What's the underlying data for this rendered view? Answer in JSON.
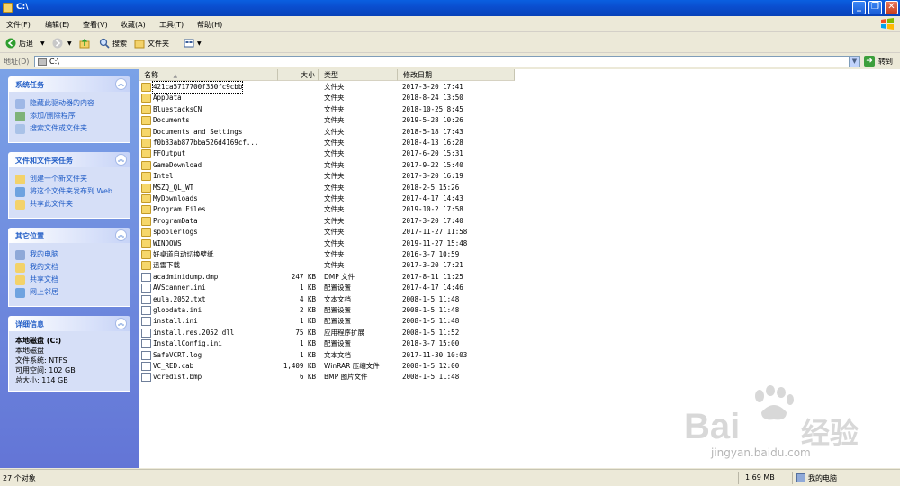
{
  "window": {
    "title": "C:\\"
  },
  "menu": [
    "文件(F)",
    "编辑(E)",
    "查看(V)",
    "收藏(A)",
    "工具(T)",
    "帮助(H)"
  ],
  "toolbar": {
    "back": "后退",
    "search": "搜索",
    "folders": "文件夹"
  },
  "address": {
    "label": "地址(D)",
    "value": "C:\\",
    "go": "转到"
  },
  "tasks": {
    "system": {
      "title": "系统任务",
      "items": [
        "隐藏此驱动器的内容",
        "添加/删除程序",
        "搜索文件或文件夹"
      ]
    },
    "file": {
      "title": "文件和文件夹任务",
      "items": [
        "创建一个新文件夹",
        "将这个文件夹发布到 Web",
        "共享此文件夹"
      ]
    },
    "other": {
      "title": "其它位置",
      "items": [
        "我的电脑",
        "我的文档",
        "共享文档",
        "网上邻居"
      ]
    },
    "details": {
      "title": "详细信息",
      "name": "本地磁盘 (C:)",
      "type": "本地磁盘",
      "fs": "文件系统: NTFS",
      "free": "可用空间: 102 GB",
      "total": "总大小: 114 GB"
    }
  },
  "columns": {
    "name": "名称",
    "size": "大小",
    "type": "类型",
    "date": "修改日期"
  },
  "files": [
    {
      "name": "421ca5717700f350fc9cbb",
      "size": "",
      "type": "文件夹",
      "date": "2017-3-20 17:41",
      "kind": "folder"
    },
    {
      "name": "AppData",
      "size": "",
      "type": "文件夹",
      "date": "2018-8-24 13:50",
      "kind": "folder"
    },
    {
      "name": "BluestacksCN",
      "size": "",
      "type": "文件夹",
      "date": "2018-10-25 8:45",
      "kind": "folder"
    },
    {
      "name": "Documents",
      "size": "",
      "type": "文件夹",
      "date": "2019-5-28 10:26",
      "kind": "folder"
    },
    {
      "name": "Documents and Settings",
      "size": "",
      "type": "文件夹",
      "date": "2018-5-18 17:43",
      "kind": "folder"
    },
    {
      "name": "f0b33ab877bba526d4169cf...",
      "size": "",
      "type": "文件夹",
      "date": "2018-4-13 16:28",
      "kind": "folder"
    },
    {
      "name": "FFOutput",
      "size": "",
      "type": "文件夹",
      "date": "2017-6-20 15:31",
      "kind": "folder"
    },
    {
      "name": "GameDownload",
      "size": "",
      "type": "文件夹",
      "date": "2017-9-22 15:40",
      "kind": "folder"
    },
    {
      "name": "Intel",
      "size": "",
      "type": "文件夹",
      "date": "2017-3-20 16:19",
      "kind": "folder"
    },
    {
      "name": "MSZQ_QL_WT",
      "size": "",
      "type": "文件夹",
      "date": "2018-2-5 15:26",
      "kind": "folder"
    },
    {
      "name": "MyDownloads",
      "size": "",
      "type": "文件夹",
      "date": "2017-4-17 14:43",
      "kind": "folder"
    },
    {
      "name": "Program Files",
      "size": "",
      "type": "文件夹",
      "date": "2019-10-2 17:58",
      "kind": "folder"
    },
    {
      "name": "ProgramData",
      "size": "",
      "type": "文件夹",
      "date": "2017-3-20 17:40",
      "kind": "folder"
    },
    {
      "name": "spoolerlogs",
      "size": "",
      "type": "文件夹",
      "date": "2017-11-27 11:58",
      "kind": "folder"
    },
    {
      "name": "WINDOWS",
      "size": "",
      "type": "文件夹",
      "date": "2019-11-27 15:48",
      "kind": "folder"
    },
    {
      "name": "好桌道自动切换壁纸",
      "size": "",
      "type": "文件夹",
      "date": "2016-3-7 10:59",
      "kind": "folder"
    },
    {
      "name": "迅雷下载",
      "size": "",
      "type": "文件夹",
      "date": "2017-3-20 17:21",
      "kind": "folder"
    },
    {
      "name": "acadminidump.dmp",
      "size": "247 KB",
      "type": "DMP 文件",
      "date": "2017-8-11 11:25",
      "kind": "file"
    },
    {
      "name": "AVScanner.ini",
      "size": "1 KB",
      "type": "配置设置",
      "date": "2017-4-17 14:46",
      "kind": "file"
    },
    {
      "name": "eula.2052.txt",
      "size": "4 KB",
      "type": "文本文档",
      "date": "2008-1-5 11:48",
      "kind": "file"
    },
    {
      "name": "globdata.ini",
      "size": "2 KB",
      "type": "配置设置",
      "date": "2008-1-5 11:48",
      "kind": "file"
    },
    {
      "name": "install.ini",
      "size": "1 KB",
      "type": "配置设置",
      "date": "2008-1-5 11:48",
      "kind": "file"
    },
    {
      "name": "install.res.2052.dll",
      "size": "75 KB",
      "type": "应用程序扩展",
      "date": "2008-1-5 11:52",
      "kind": "file"
    },
    {
      "name": "InstallConfig.ini",
      "size": "1 KB",
      "type": "配置设置",
      "date": "2018-3-7 15:00",
      "kind": "file"
    },
    {
      "name": "SafeVCRT.log",
      "size": "1 KB",
      "type": "文本文档",
      "date": "2017-11-30 10:03",
      "kind": "file"
    },
    {
      "name": "VC_RED.cab",
      "size": "1,409 KB",
      "type": "WinRAR 压缩文件",
      "date": "2008-1-5 12:00",
      "kind": "file"
    },
    {
      "name": "vcredist.bmp",
      "size": "6 KB",
      "type": "BMP 图片文件",
      "date": "2008-1-5 11:48",
      "kind": "file"
    }
  ],
  "status": {
    "count": "27 个对象",
    "size": "1.69 MB",
    "location": "我的电脑"
  },
  "watermark": {
    "brand": "Bai",
    "brand2": "经验",
    "url": "jingyan.baidu.com"
  },
  "colors": {
    "titlebar": "#0a4fd0",
    "taskpane": "#7ba2e7",
    "link": "#215dc6"
  }
}
